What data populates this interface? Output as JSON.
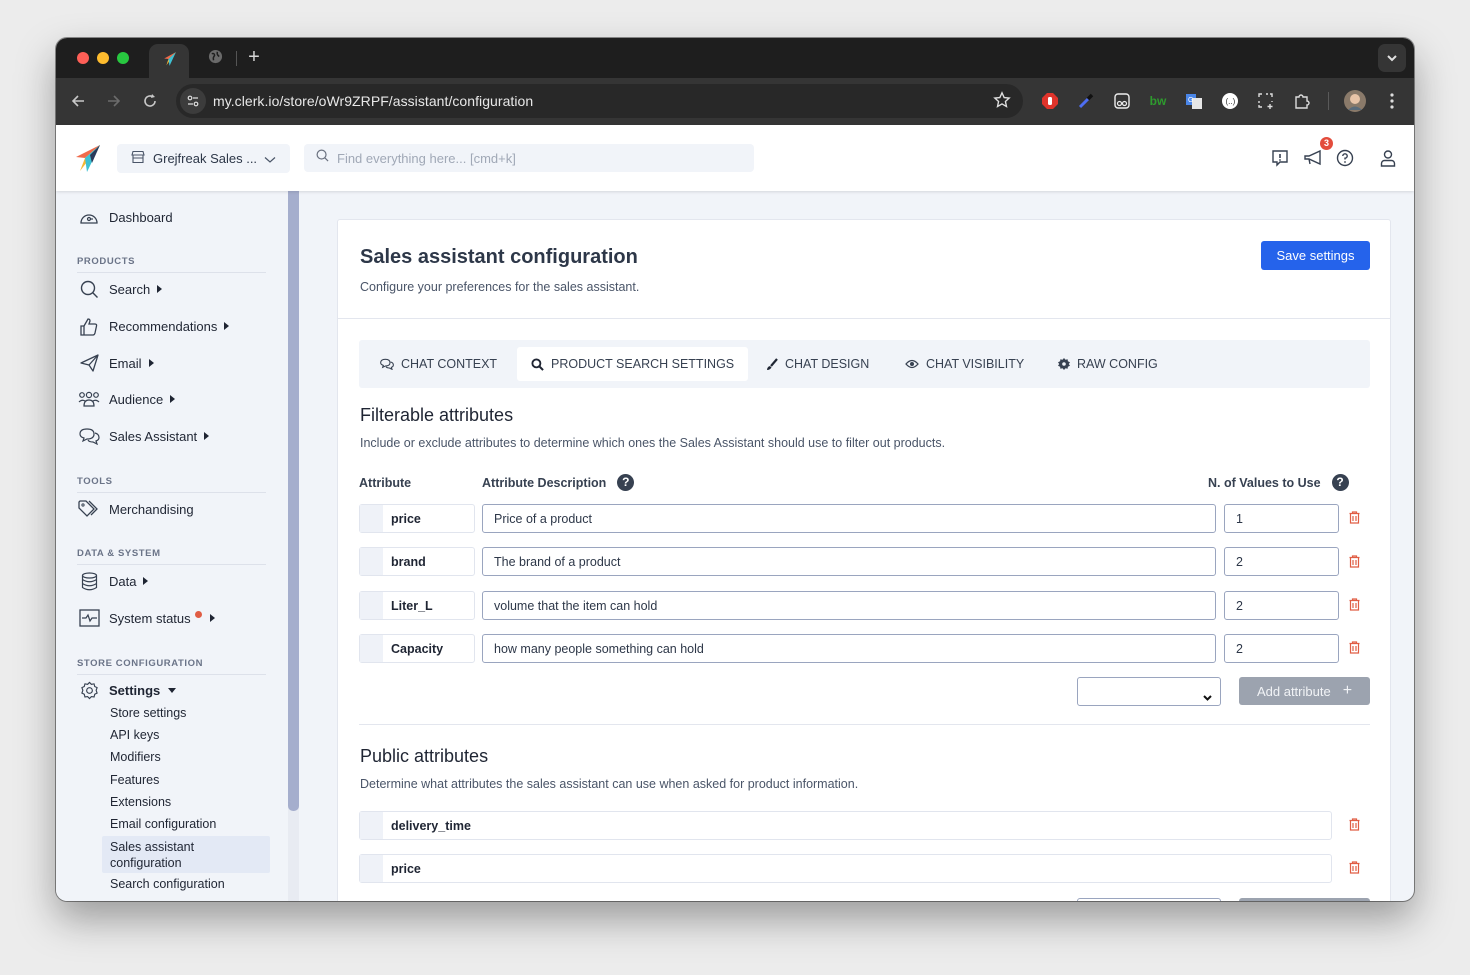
{
  "browser": {
    "url": "my.clerk.io/store/oWr9ZRPF/assistant/configuration",
    "tabs": [
      {
        "icon": "clerk-logo-icon",
        "active": true
      },
      {
        "icon": "globe-icon",
        "active": false
      }
    ],
    "extensions": [
      "adblock-icon",
      "eyedropper-icon",
      "ghostery-icon",
      "bw-icon",
      "google-translate-icon",
      "dark-reader-icon",
      "screenshot-icon",
      "extensions-puzzle-icon"
    ]
  },
  "header": {
    "store_name": "Grejfreak Sales ...",
    "search_placeholder": "Find everything here... [cmd+k]",
    "notification_count": "3"
  },
  "sidebar": {
    "dashboard": "Dashboard",
    "sections": {
      "products": "PRODUCTS",
      "tools": "TOOLS",
      "data_system": "DATA & SYSTEM",
      "store_config": "STORE CONFIGURATION"
    },
    "items": {
      "search": "Search",
      "recommendations": "Recommendations",
      "email": "Email",
      "audience": "Audience",
      "sales_assistant": "Sales Assistant",
      "merchandising": "Merchandising",
      "data": "Data",
      "system_status": "System status",
      "settings": "Settings"
    },
    "settings_sub": [
      "Store settings",
      "API keys",
      "Modifiers",
      "Features",
      "Extensions",
      "Email configuration",
      "Sales assistant configuration",
      "Search configuration"
    ],
    "active_sub": "Sales assistant configuration"
  },
  "main": {
    "title": "Sales assistant configuration",
    "subtitle": "Configure your preferences for the sales assistant.",
    "save_label": "Save settings",
    "colors": {
      "primary": "#2563eb",
      "danger": "#e05d44"
    },
    "tabs": [
      {
        "label": "CHAT CONTEXT",
        "icon": "chat-bubbles-icon",
        "active": false
      },
      {
        "label": "PRODUCT SEARCH SETTINGS",
        "icon": "search-icon",
        "active": true
      },
      {
        "label": "CHAT DESIGN",
        "icon": "paintbrush-icon",
        "active": false
      },
      {
        "label": "CHAT VISIBILITY",
        "icon": "eye-icon",
        "active": false
      },
      {
        "label": "RAW CONFIG",
        "icon": "gear-icon",
        "active": false
      }
    ],
    "filterable": {
      "title": "Filterable attributes",
      "description": "Include or exclude attributes to determine which ones the Sales Assistant should use to filter out products.",
      "col_attribute": "Attribute",
      "col_description": "Attribute Description",
      "col_values": "N. of Values to Use",
      "rows": [
        {
          "name": "price",
          "description": "Price of a product",
          "values": "1"
        },
        {
          "name": "brand",
          "description": "The brand of a product",
          "values": "2"
        },
        {
          "name": "Liter_L",
          "description": "volume that the item can hold",
          "values": "2"
        },
        {
          "name": "Capacity",
          "description": "how many people something can hold",
          "values": "2"
        }
      ],
      "select_value": "",
      "add_label": "Add attribute"
    },
    "public": {
      "title": "Public attributes",
      "description": "Determine what attributes the sales assistant can use when asked for product information.",
      "rows": [
        {
          "name": "delivery_time"
        },
        {
          "name": "price"
        }
      ]
    }
  }
}
